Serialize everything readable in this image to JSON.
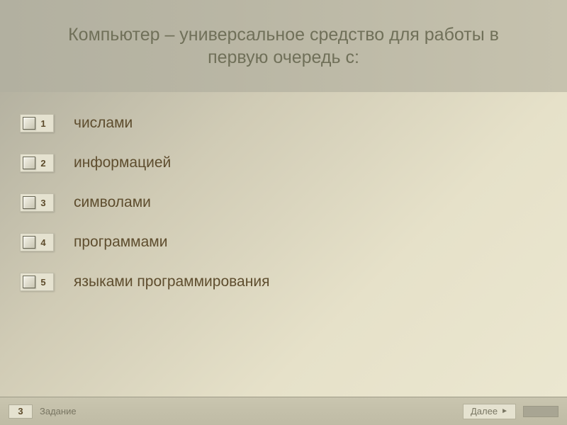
{
  "header": {
    "title": "Компьютер – универсальное средство для работы в первую очередь с:"
  },
  "options": [
    {
      "num": "1",
      "label": "числами"
    },
    {
      "num": "2",
      "label": "информацией"
    },
    {
      "num": "3",
      "label": "символами"
    },
    {
      "num": "4",
      "label": "программами"
    },
    {
      "num": "5",
      "label": "языками программирования"
    }
  ],
  "footer": {
    "taskNumber": "3",
    "taskLabel": "Задание",
    "nextLabel": "Далее",
    "nextArrow": "►"
  }
}
